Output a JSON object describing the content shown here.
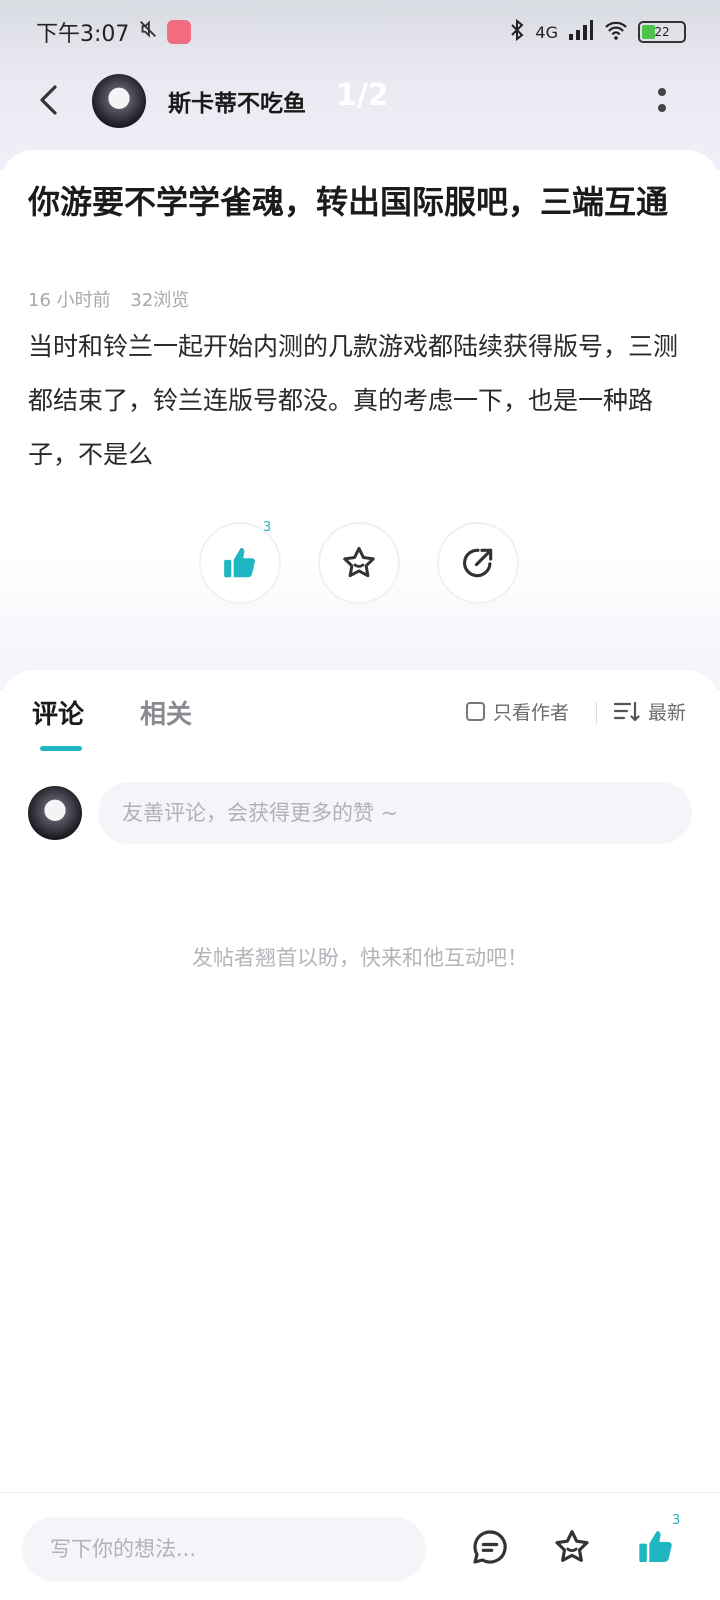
{
  "status_bar": {
    "time": "下午3:07",
    "network": "4G",
    "battery": "22"
  },
  "header": {
    "author_name": "斯卡蒂不吃鱼",
    "page_indicator": "1/2"
  },
  "post": {
    "title": "你游要不学学雀魂，转出国际服吧，三端互通",
    "time_ago": "16 小时前",
    "views": "32浏览",
    "body": "当时和铃兰一起开始内测的几款游戏都陆续获得版号，三测都结束了，铃兰连版号都没。真的考虑一下，也是一种路子，不是么",
    "like_count": "3"
  },
  "comments": {
    "tabs": [
      {
        "label": "评论",
        "active": true
      },
      {
        "label": "相关",
        "active": false
      }
    ],
    "author_only_label": "只看作者",
    "sort_label": "最新",
    "input_placeholder": "友善评论，会获得更多的赞 ~",
    "empty_hint": "发帖者翘首以盼，快来和他互动吧！"
  },
  "bottom_bar": {
    "input_placeholder": "写下你的想法...",
    "like_count": "3"
  },
  "colors": {
    "accent": "#21b5c3",
    "like_blue": "#1fb6c1"
  }
}
